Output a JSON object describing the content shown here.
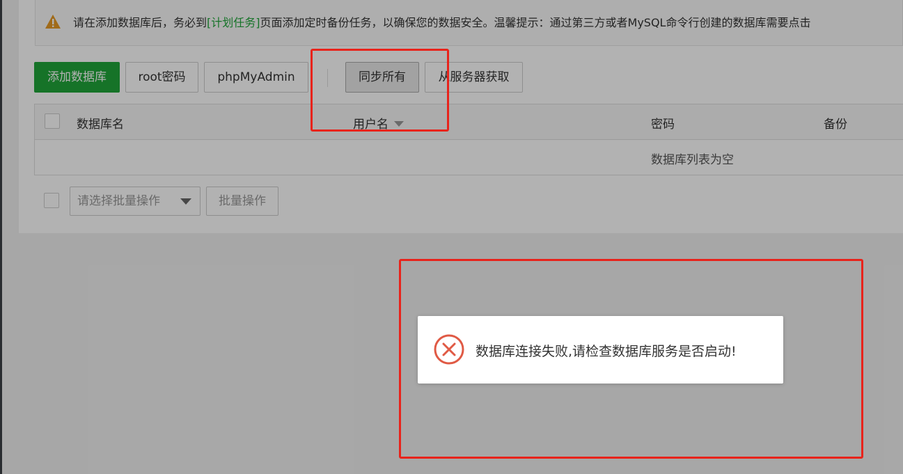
{
  "alert": {
    "text_before": "请在添加数据库后，务必到",
    "link": "[计划任务]",
    "text_after": "页面添加定时备份任务，以确保您的数据安全。温馨提示：通过第三方或者MySQL命令行创建的数据库需要点击"
  },
  "toolbar": {
    "add_db": "添加数据库",
    "root_password": "root密码",
    "phpmyadmin": "phpMyAdmin",
    "sync_all": "同步所有",
    "fetch_from_server": "从服务器获取"
  },
  "table": {
    "columns": [
      "数据库名",
      "用户名",
      "密码",
      "备份"
    ],
    "empty_text": "数据库列表为空"
  },
  "batch": {
    "select_placeholder": "请选择批量操作",
    "button": "批量操作"
  },
  "toast": {
    "message": "数据库连接失败,请检查数据库服务是否启动!"
  },
  "colors": {
    "primary_green": "#20a53a",
    "annotation_red": "#e8231b",
    "error_red": "#e05a45",
    "warning_orange": "#e59a26"
  }
}
